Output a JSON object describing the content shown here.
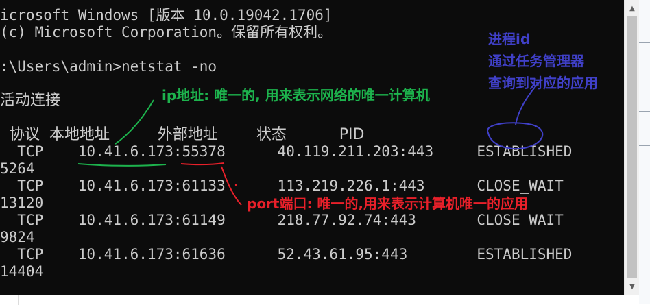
{
  "console": {
    "lines": [
      "icrosoft Windows [版本 10.0.19042.1706]",
      "(c) Microsoft Corporation。保留所有权利。",
      "",
      ":\\Users\\admin>netstat -no",
      "",
      "活动连接",
      "",
      "  协议  本地地址          外部地址        状态           PID",
      "  TCP    10.41.6.173:55378      40.119.211.203:443     ESTABLISHED",
      "5264",
      "  TCP    10.41.6.173:61133      113.219.226.1:443      CLOSE_WAIT",
      "13120",
      "  TCP    10.41.6.173:61149      218.77.92.74:443       CLOSE_WAIT",
      "9824",
      "  TCP    10.41.6.173:61636      52.43.61.95:443        ESTABLISHED",
      "14404"
    ]
  },
  "annotations": {
    "ip": "ip地址: 唯一的, 用来表示网络的唯一计算机",
    "port": "port端口: 唯一的,用来表示计算机唯一的应用",
    "pid_line1": "进程id",
    "pid_line2": "通过任务管理器",
    "pid_line3": "查询到对应的应用"
  },
  "colors": {
    "console_bg": "#0c0c0c",
    "console_text": "#cccccc",
    "green": "#1db34d",
    "red": "#e8202a",
    "blue": "#4040c8"
  },
  "icons": {
    "scroll_up": "triangle-up-icon",
    "scroll_down": "triangle-down-icon"
  }
}
